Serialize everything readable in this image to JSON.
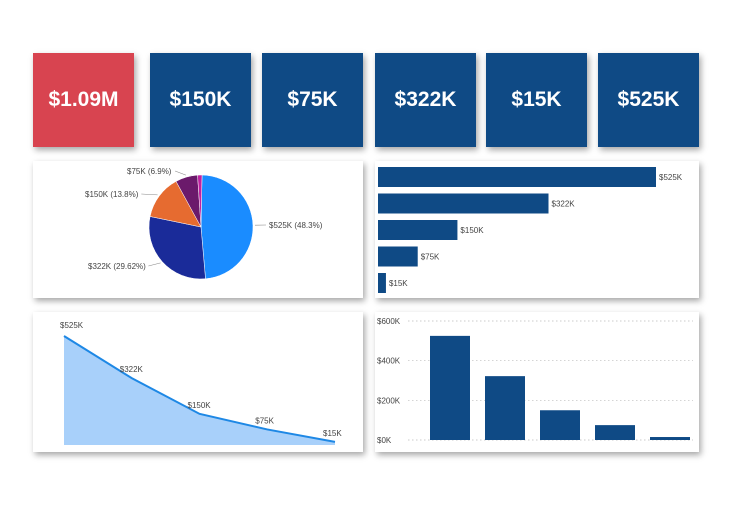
{
  "colors": {
    "navy": "#0f4a85",
    "red": "#d84450",
    "pie_blue": "#1a8cff",
    "pie_indigo": "#1a2b99",
    "pie_orange": "#e66b30",
    "pie_purple": "#6b1a6b",
    "pie_magenta": "#c020a0",
    "area_fill": "#a8d0fa",
    "area_line": "#1e88e5"
  },
  "kpis": [
    "$1.09M",
    "$150K",
    "$75K",
    "$322K",
    "$15K",
    "$525K"
  ],
  "chart_data": [
    {
      "type": "pie",
      "slices": [
        {
          "label": "$525K (48.3%)",
          "value": 48.3
        },
        {
          "label": "$322K (29.62%)",
          "value": 29.62
        },
        {
          "label": "$150K (13.8%)",
          "value": 13.8
        },
        {
          "label": "$75K (6.9%)",
          "value": 6.9
        },
        {
          "label": "",
          "value": 1.38
        }
      ]
    },
    {
      "type": "bar",
      "orientation": "horizontal",
      "categories": [
        "$525K",
        "$322K",
        "$150K",
        "$75K",
        "$15K"
      ],
      "values": [
        525,
        322,
        150,
        75,
        15
      ],
      "data_labels": [
        "$525K",
        "$322K",
        "$150K",
        "$75K",
        "$15K"
      ]
    },
    {
      "type": "area",
      "values": [
        525,
        322,
        150,
        75,
        15
      ],
      "data_labels": [
        "$525K",
        "$322K",
        "$150K",
        "$75K",
        "$15K"
      ]
    },
    {
      "type": "bar",
      "values": [
        525,
        322,
        150,
        75,
        15
      ],
      "ylim": [
        0,
        600
      ],
      "yticks": [
        "$0K",
        "$200K",
        "$400K",
        "$600K"
      ],
      "ytick_values": [
        0,
        200,
        400,
        600
      ],
      "grid": true
    }
  ]
}
